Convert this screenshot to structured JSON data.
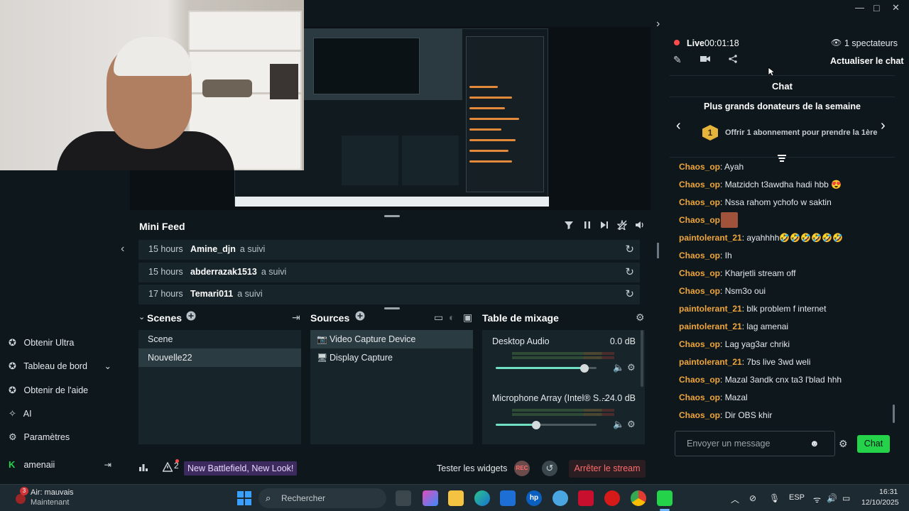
{
  "window": {
    "collapse_arrow": "›",
    "minimize": "—",
    "maximize": "□",
    "close": "✕"
  },
  "minifeed": {
    "title": "Mini Feed",
    "rows": [
      {
        "time": "15 hours",
        "name": "Amine_djn",
        "action": "a suivi"
      },
      {
        "time": "15 hours",
        "name": "abderrazak1513",
        "action": "a suivi"
      },
      {
        "time": "17 hours",
        "name": "Temari011",
        "action": "a suivi"
      }
    ]
  },
  "scenes": {
    "title": "Scenes",
    "items": [
      "Scene",
      "Nouvelle22"
    ],
    "selected_index": 1
  },
  "sources": {
    "title": "Sources",
    "items": [
      "Video Capture Device",
      "Display Capture"
    ],
    "selected_index": 0
  },
  "mixer": {
    "title": "Table de mixage",
    "channels": [
      {
        "label": "Desktop Audio",
        "db": "0.0 dB",
        "level": 0.88
      },
      {
        "label": "Microphone Array (Intel® S...",
        "db": "-24.0 dB",
        "level": 0.4
      }
    ]
  },
  "footer": {
    "alerts_count": "2",
    "promo": "New Battlefield, New Look!",
    "test_widgets": "Tester les widgets",
    "rec": "REC",
    "stop_stream": "Arrêter le stream"
  },
  "nav": {
    "items": [
      {
        "label": "Obtenir Ultra"
      },
      {
        "label": "Tableau de bord"
      },
      {
        "label": "Obtenir de l'aide"
      },
      {
        "label": "AI"
      },
      {
        "label": "Paramètres"
      }
    ],
    "user": "amenaii"
  },
  "chat": {
    "live_label": "Live",
    "live_time": "00:01:18",
    "viewers": "1 spectateurs",
    "refresh": "Actualiser le chat",
    "title": "Chat",
    "donors_title": "Plus grands donateurs de la semaine",
    "donor_rank": "1",
    "donor_text": "Offrir 1 abonnement pour prendre la 1ère",
    "messages": [
      {
        "user": "Chaos_op",
        "text": "Ayah"
      },
      {
        "user": "Chaos_op",
        "text": "Matzidch t3awdha hadi hbb 😍"
      },
      {
        "user": "Chaos_op",
        "text": "Nssa rahom ychofo w saktin"
      },
      {
        "user": "Chaos_op",
        "text": ""
      },
      {
        "user": "paintolerant_21",
        "text": "ayahhhh🤣🤣🤣🤣🤣🤣"
      },
      {
        "user": "Chaos_op",
        "text": "Ih"
      },
      {
        "user": "Chaos_op",
        "text": "Kharjetli stream off"
      },
      {
        "user": "Chaos_op",
        "text": "Nsm3o oui"
      },
      {
        "user": "paintolerant_21",
        "text": "blk problem f internet"
      },
      {
        "user": "paintolerant_21",
        "text": "lag amenai"
      },
      {
        "user": "Chaos_op",
        "text": "Lag yag3ar chriki"
      },
      {
        "user": "paintolerant_21",
        "text": "7bs live 3wd weli"
      },
      {
        "user": "Chaos_op",
        "text": "Mazal 3andk cnx ta3 l'blad hhh"
      },
      {
        "user": "Chaos_op",
        "text": "Mazal"
      },
      {
        "user": "Chaos_op",
        "text": "Dir OBS khir"
      }
    ],
    "input_placeholder": "Envoyer un message",
    "send": "Chat"
  },
  "taskbar": {
    "weather_badge": "3",
    "weather": "Air: mauvais",
    "weather_sub": "Maintenant",
    "search_placeholder": "Rechercher",
    "lang": "ESP",
    "time": "16:31",
    "date": "12/10/2025"
  },
  "colors": {
    "accent_green": "#25d34a",
    "username": "#f0a63b",
    "live_red": "#ff4b4b",
    "stop_red": "#ff6b6b"
  }
}
